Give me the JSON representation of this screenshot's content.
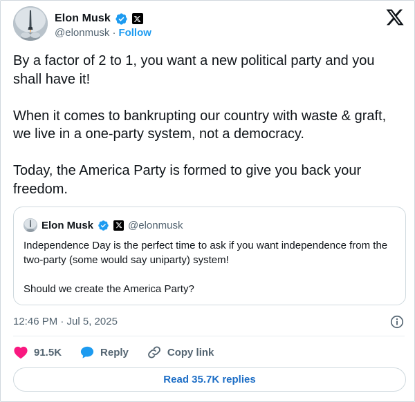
{
  "author": {
    "display_name": "Elon Musk",
    "handle": "@elonmusk",
    "separator": "·",
    "follow_label": "Follow",
    "avatar_icon": "rocket-launch-avatar",
    "verified_icon": "verified-badge-icon",
    "affiliate_icon": "x-affiliate-badge-icon"
  },
  "platform_icon": "x-logo-icon",
  "tweet": {
    "paragraphs": [
      "By a factor of 2 to 1, you want a new political party and you shall have it!",
      "When it comes to bankrupting our country with waste & graft, we live in a one-party system, not a democracy.",
      "Today, the America Party is formed to give you back your freedom."
    ],
    "timestamp": "12:46 PM · Jul 5, 2025"
  },
  "quoted_tweet": {
    "display_name": "Elon Musk",
    "handle": "@elonmusk",
    "paragraphs": [
      "Independence Day is the perfect time to ask if you want independence from the two-party (some would say uniparty) system!",
      "Should we create the America Party?"
    ]
  },
  "actions": {
    "likes": "91.5K",
    "reply_label": "Reply",
    "copy_link_label": "Copy link"
  },
  "read_replies_label": "Read 35.7K replies",
  "colors": {
    "accent_blue": "#1d9bf0",
    "like_pink": "#f91880",
    "text_primary": "#0f1419",
    "text_secondary": "#536471"
  }
}
